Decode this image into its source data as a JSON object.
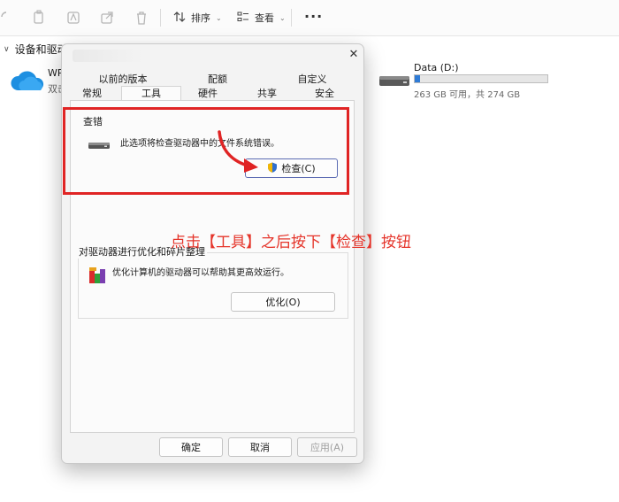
{
  "toolbar": {
    "sort_label": "排序",
    "view_label": "查看",
    "more_label": "···"
  },
  "section": {
    "title": "设备和驱动器"
  },
  "cloud_item": {
    "name": "WP",
    "sub": "双击"
  },
  "drive": {
    "title": "Data (D:)",
    "info": "263 GB 可用，共 274 GB",
    "used_fraction": 0.04,
    "bar_color": "#2f7bd6"
  },
  "dialog": {
    "close_glyph": "✕",
    "tabs_row1": [
      "以前的版本",
      "配额",
      "自定义"
    ],
    "tabs_row2": [
      "常规",
      "工具",
      "硬件",
      "共享",
      "安全"
    ],
    "active_tab": "工具",
    "error_check": {
      "title": "查错",
      "desc": "此选项将检查驱动器中的文件系统错误。",
      "button": "检查(C)"
    },
    "optimize": {
      "title": "对驱动器进行优化和碎片整理",
      "desc": "优化计算机的驱动器可以帮助其更高效运行。",
      "button": "优化(O)"
    },
    "footer": {
      "ok": "确定",
      "cancel": "取消",
      "apply": "应用(A)"
    }
  },
  "annotation": {
    "text": "点击【工具】之后按下【检查】按钮",
    "color": "#e5342a"
  }
}
